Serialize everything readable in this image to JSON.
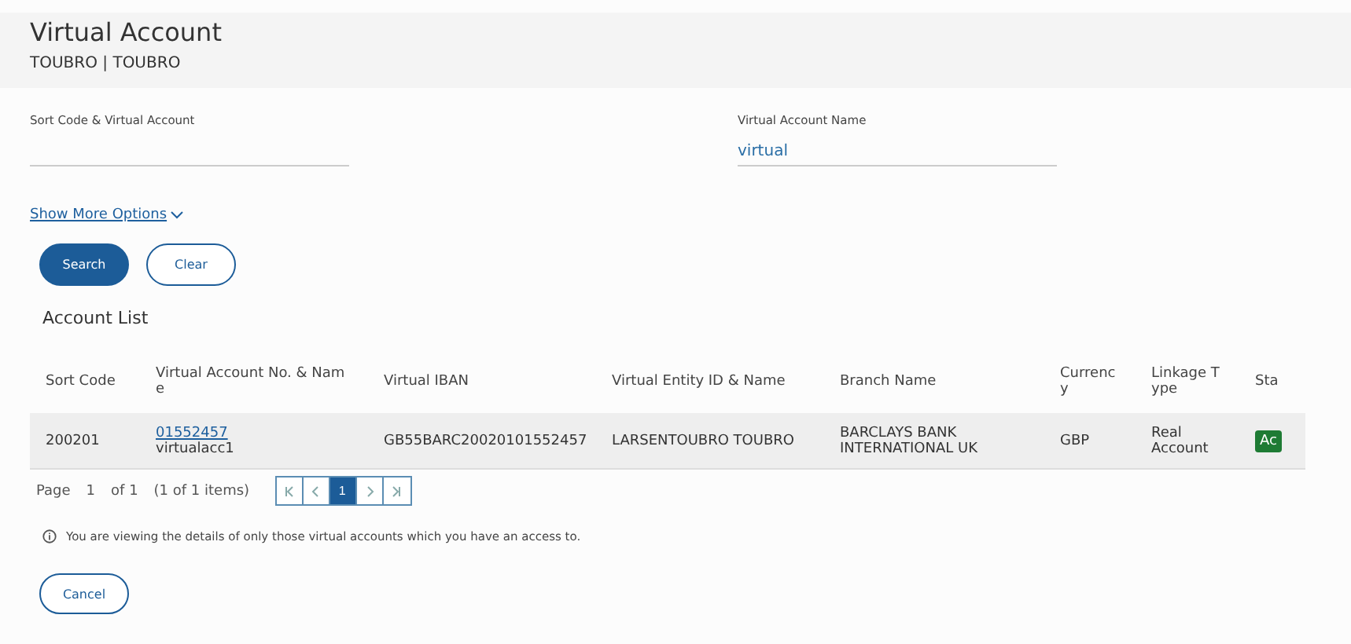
{
  "header": {
    "title": "Virtual Account",
    "subtitle": "TOUBRO | TOUBRO"
  },
  "fields": [
    {
      "label": "Sort Code & Virtual Account"
    },
    {
      "label": "Virtual Account Name",
      "value": "virtual"
    }
  ],
  "show_more": "Show More Options",
  "buttons": [
    {
      "label": "Search",
      "kind": "primary"
    },
    {
      "label": "Clear",
      "kind": "outline"
    }
  ],
  "list_title": "Account List",
  "table": {
    "columns": [
      "Sort Code",
      "Virtual Account No. & Name",
      "Virtual IBAN",
      "Virtual Entity ID & Name",
      "Branch Name",
      "Currency",
      "Linkage Type",
      "Sta"
    ],
    "rows": [
      {
        "sort_code": "200201",
        "account_no": "01552457",
        "account_name": "virtualacc1",
        "iban": "GB55BARC20020101552457",
        "entity": "LARSENTOUBRO TOUBRO",
        "branch": "BARCLAYS BANK INTERNATIONAL UK",
        "currency": "GBP",
        "linkage": "Real Account",
        "status": "Ac"
      }
    ]
  },
  "pagination": {
    "page_label": "Page",
    "page": "1",
    "of": "of 1",
    "items": "(1 of 1 items)",
    "pages": [
      {
        "label": "1",
        "selected": true
      }
    ]
  },
  "info": "You are viewing the details of only those virtual accounts which you have an access to.",
  "cancel": "Cancel"
}
